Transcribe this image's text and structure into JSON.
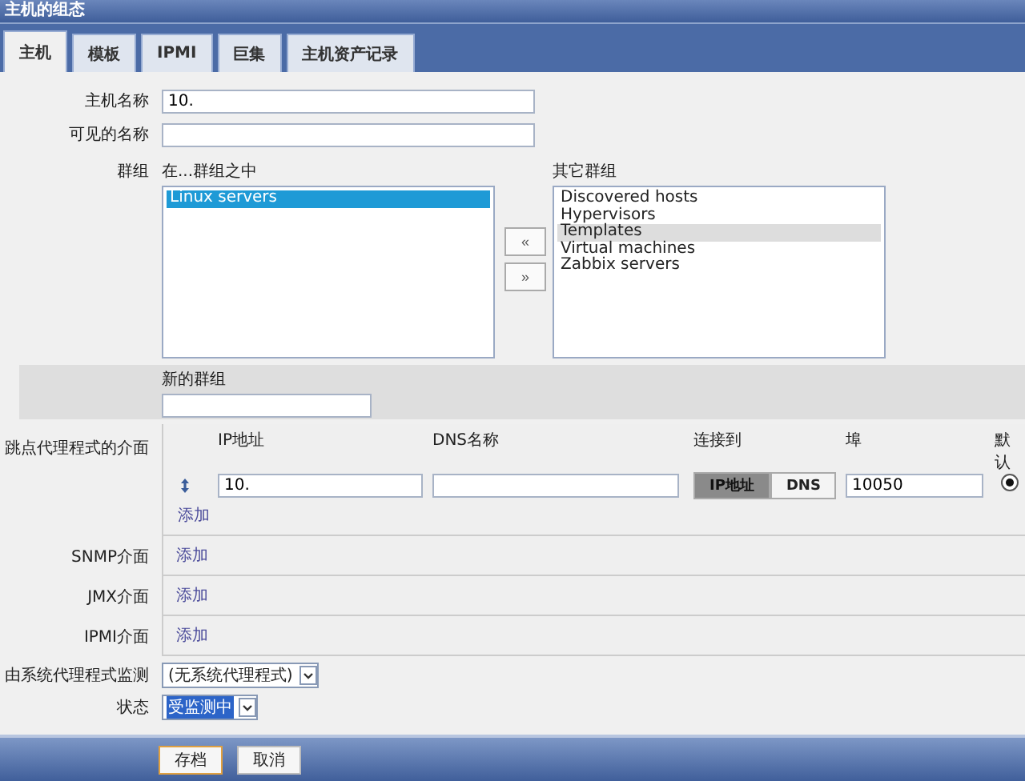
{
  "window": {
    "title": "主机的组态"
  },
  "tabs": [
    {
      "label": "主机",
      "selected": true
    },
    {
      "label": "模板",
      "selected": false
    },
    {
      "label": "IPMI",
      "selected": false
    },
    {
      "label": "巨集",
      "selected": false
    },
    {
      "label": "主机资产记录",
      "selected": false
    }
  ],
  "host_name": {
    "label": "主机名称",
    "value": "10."
  },
  "visible_name": {
    "label": "可见的名称"
  },
  "groups": {
    "label": "群组",
    "in_groups": {
      "heading": "在...群组之中",
      "focused": true,
      "items": [
        {
          "label": "Linux servers",
          "selected": true
        }
      ]
    },
    "other_groups": {
      "heading": "其它群组",
      "focused": false,
      "items": [
        {
          "label": "Discovered hosts",
          "selected": false
        },
        {
          "label": "Hypervisors",
          "selected": false
        },
        {
          "label": "Templates",
          "selected": true
        },
        {
          "label": "Virtual machines",
          "selected": false
        },
        {
          "label": "Zabbix servers",
          "selected": false
        }
      ]
    },
    "move_buttons": [
      "«",
      "»"
    ]
  },
  "new_group": {
    "label": "新的群组"
  },
  "agent_interfaces": {
    "label": "跳点代理程式的介面",
    "columns": [
      "IP地址",
      "DNS名称",
      "连接到",
      "埠",
      "默认"
    ],
    "rows": [
      {
        "ip": "10.",
        "connect_options": [
          {
            "label": "IP地址",
            "selected": true
          },
          {
            "label": "DNS",
            "selected": false
          }
        ],
        "port": "10050",
        "default": true
      }
    ],
    "add_link": "添加"
  },
  "other_interfaces": [
    {
      "label": "SNMP介面",
      "add_link": "添加"
    },
    {
      "label": "JMX介面",
      "add_link": "添加"
    },
    {
      "label": "IPMI介面",
      "add_link": "添加"
    }
  ],
  "proxy": {
    "label": "由系统代理程式监测",
    "value": "(无系统代理程式)",
    "highlighted": false
  },
  "status": {
    "label": "状态",
    "value": "受监测中",
    "highlighted": true
  },
  "buttons": [
    {
      "label": "存档",
      "kind": "primary"
    },
    {
      "label": "取消",
      "kind": "secondary"
    }
  ]
}
